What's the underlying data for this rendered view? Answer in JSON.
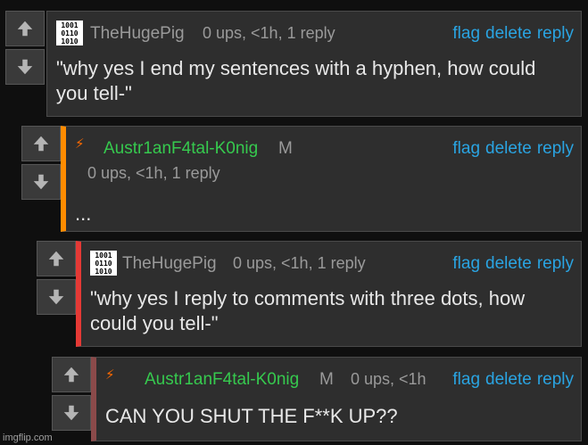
{
  "colors": {
    "accent_orange": "#ff8c00",
    "accent_red": "#e53935",
    "accent_maroon": "#8b4a4a",
    "link_blue": "#2aa4e2",
    "username_green": "#36c94e"
  },
  "icons": {
    "upvote": "arrow-up-icon",
    "downvote": "arrow-down-icon",
    "lightning": "lightning-icon"
  },
  "actions": {
    "flag": "flag",
    "delete": "delete",
    "reply": "reply"
  },
  "comments": [
    {
      "username": "TheHugePig",
      "avatar_text": "1001\n0110\n1010",
      "meta": "0 ups, <1h, 1 reply",
      "text": "\"why yes I end my sentences with a hyphen, how could you tell-\""
    },
    {
      "username": "Austr1anF4tal-K0nig",
      "mod_flag": "M",
      "meta": "0 ups, <1h, 1 reply",
      "text": "..."
    },
    {
      "username": "TheHugePig",
      "avatar_text": "1001\n0110\n1010",
      "meta": "0 ups, <1h, 1 reply",
      "text": "\"why yes I reply to comments with three dots, how could you tell-\""
    },
    {
      "username": "Austr1anF4tal-K0nig",
      "mod_flag": "M",
      "meta": "0 ups, <1h",
      "text": "CAN YOU SHUT THE F**K UP??"
    }
  ],
  "watermark": "imgflip.com"
}
